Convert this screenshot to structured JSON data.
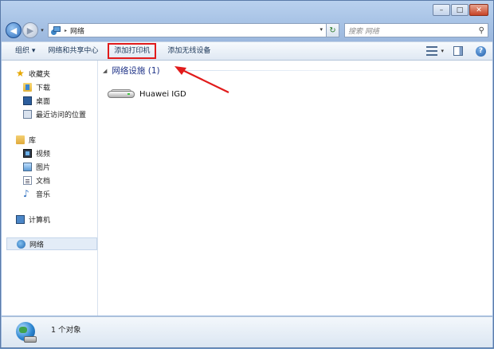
{
  "window": {
    "caption_buttons": {
      "minimize": "–",
      "maximize": "□",
      "close": "✕"
    }
  },
  "address_bar": {
    "breadcrumb": [
      "网络"
    ],
    "separator": "▸",
    "search_placeholder": "搜索 网络"
  },
  "toolbar": {
    "items": [
      "组织 ▾",
      "网络和共享中心",
      "添加打印机",
      "添加无线设备"
    ],
    "highlighted_index": 2,
    "view_arrow": "▾"
  },
  "nav_pane": {
    "favorites": {
      "label": "收藏夹",
      "items": [
        "下载",
        "桌面",
        "最近访问的位置"
      ]
    },
    "libraries": {
      "label": "库",
      "items": [
        "视频",
        "图片",
        "文档",
        "音乐"
      ]
    },
    "computer": "计算机",
    "network": "网络"
  },
  "content": {
    "group_title": "网络设施 (1)",
    "devices": [
      {
        "name": "Huawei IGD",
        "icon": "router-icon"
      }
    ]
  },
  "status_bar": {
    "text": "1 个对象"
  },
  "annotation": {
    "color": "#e11b1b"
  }
}
